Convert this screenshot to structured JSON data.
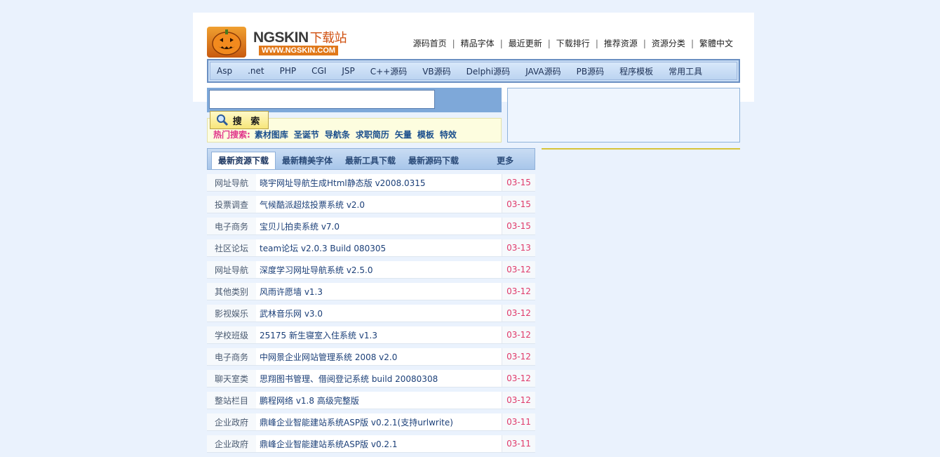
{
  "logo": {
    "brand": "NGSKIN",
    "brand_cn": "下载站",
    "url": "WWW.NGSKIN.COM"
  },
  "top_nav": [
    "源码首页",
    "精品字体",
    "最近更新",
    "下载排行",
    "推荐资源",
    "资源分类",
    "繁體中文"
  ],
  "categories": [
    "Asp",
    ".net",
    "PHP",
    "CGI",
    "JSP",
    "C++源码",
    "VB源码",
    "Delphi源码",
    "JAVA源码",
    "PB源码",
    "程序模板",
    "常用工具"
  ],
  "search": {
    "value": "",
    "button_label": "搜 索",
    "hot_label": "热门搜索:",
    "hot_items": [
      "素材图库",
      "圣诞节",
      "导航条",
      "求职简历",
      "矢量",
      "模板",
      "特效"
    ]
  },
  "tabs": [
    "最新资源下载",
    "最新精美字体",
    "最新工具下载",
    "最新源码下载",
    "更多"
  ],
  "rows": [
    {
      "cat": "网址导航",
      "title": "晓宇网址导航生成Html静态版 v2008.0315",
      "date": "03-15"
    },
    {
      "cat": "投票调查",
      "title": "气候酷派超炫投票系统 v2.0",
      "date": "03-15"
    },
    {
      "cat": "电子商务",
      "title": "宝贝儿拍卖系统 v7.0",
      "date": "03-15"
    },
    {
      "cat": "社区论坛",
      "title": "team论坛 v2.0.3 Build 080305",
      "date": "03-13"
    },
    {
      "cat": "网址导航",
      "title": "深度学习网址导航系统 v2.5.0",
      "date": "03-12"
    },
    {
      "cat": "其他类别",
      "title": "风雨许愿墙 v1.3",
      "date": "03-12"
    },
    {
      "cat": "影视娱乐",
      "title": "武林音乐网 v3.0",
      "date": "03-12"
    },
    {
      "cat": "学校班级",
      "title": "25175 新生寝室入住系统 v1.3",
      "date": "03-12"
    },
    {
      "cat": "电子商务",
      "title": "中网景企业网站管理系统 2008 v2.0",
      "date": "03-12"
    },
    {
      "cat": "聊天室类",
      "title": "思翔图书管理、借阅登记系统 build 20080308",
      "date": "03-12"
    },
    {
      "cat": "整站栏目",
      "title": "鹏程网络 v1.8 高级完整版",
      "date": "03-12"
    },
    {
      "cat": "企业政府",
      "title": "鼎峰企业智能建站系统ASP版 v0.2.1(支持urlwrite)",
      "date": "03-11"
    },
    {
      "cat": "企业政府",
      "title": "鼎峰企业智能建站系统ASP版 v0.2.1",
      "date": "03-11"
    }
  ]
}
